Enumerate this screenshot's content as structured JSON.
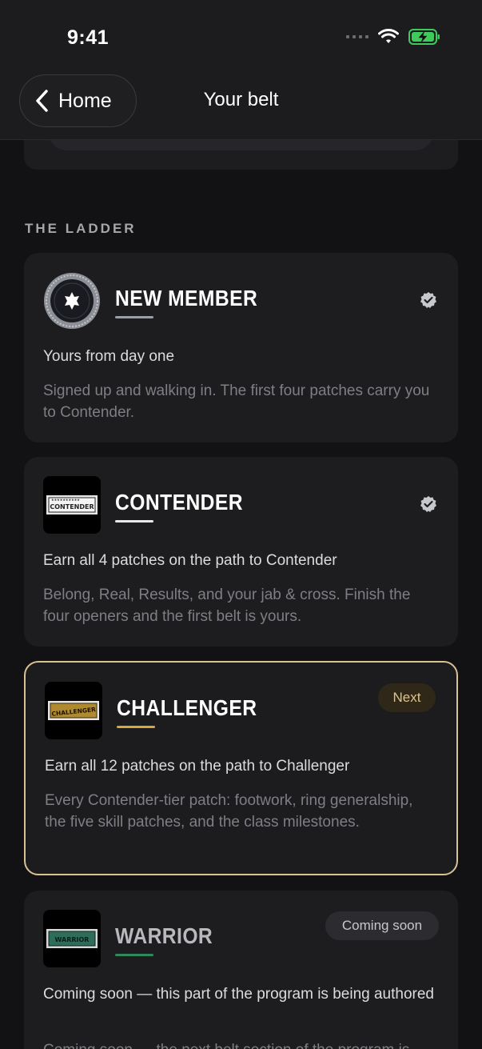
{
  "status": {
    "time": "9:41"
  },
  "nav": {
    "back_label": "Home",
    "title": "Your belt"
  },
  "section_label": "THE LADDER",
  "belts": [
    {
      "name": "NEW MEMBER",
      "subtitle": "Yours from day one",
      "description": "Signed up and walking in. The first four patches carry you to Contender.",
      "status": "earned",
      "underline_color": "#9aa0aa"
    },
    {
      "name": "CONTENDER",
      "subtitle": "Earn all 4 patches on the path to Contender",
      "description": "Belong, Real, Results, and your jab & cross. Finish the four openers and the first belt is yours.",
      "status": "earned",
      "badge_text": "CONTENDER",
      "underline_color": "#e8e8ea"
    },
    {
      "name": "CHALLENGER",
      "subtitle": "Earn all 12 patches on the path to Challenger",
      "description": "Every Contender-tier patch: footwork, ring generalship, the five skill patches, and the class milestones.",
      "status": "next",
      "pill_label": "Next",
      "badge_text": "CHALLENGER",
      "underline_color": "#d4a83a"
    },
    {
      "name": "WARRIOR",
      "subtitle": "Coming soon — this part of the program is being authored",
      "description": "Coming soon — the next belt section of the program is",
      "status": "locked",
      "pill_label": "Coming soon",
      "badge_text": "WARRIOR",
      "underline_color": "#2e8a5e"
    }
  ],
  "colors": {
    "accent_gold": "#d9c293",
    "background": "#121214",
    "card": "#1d1d20"
  }
}
